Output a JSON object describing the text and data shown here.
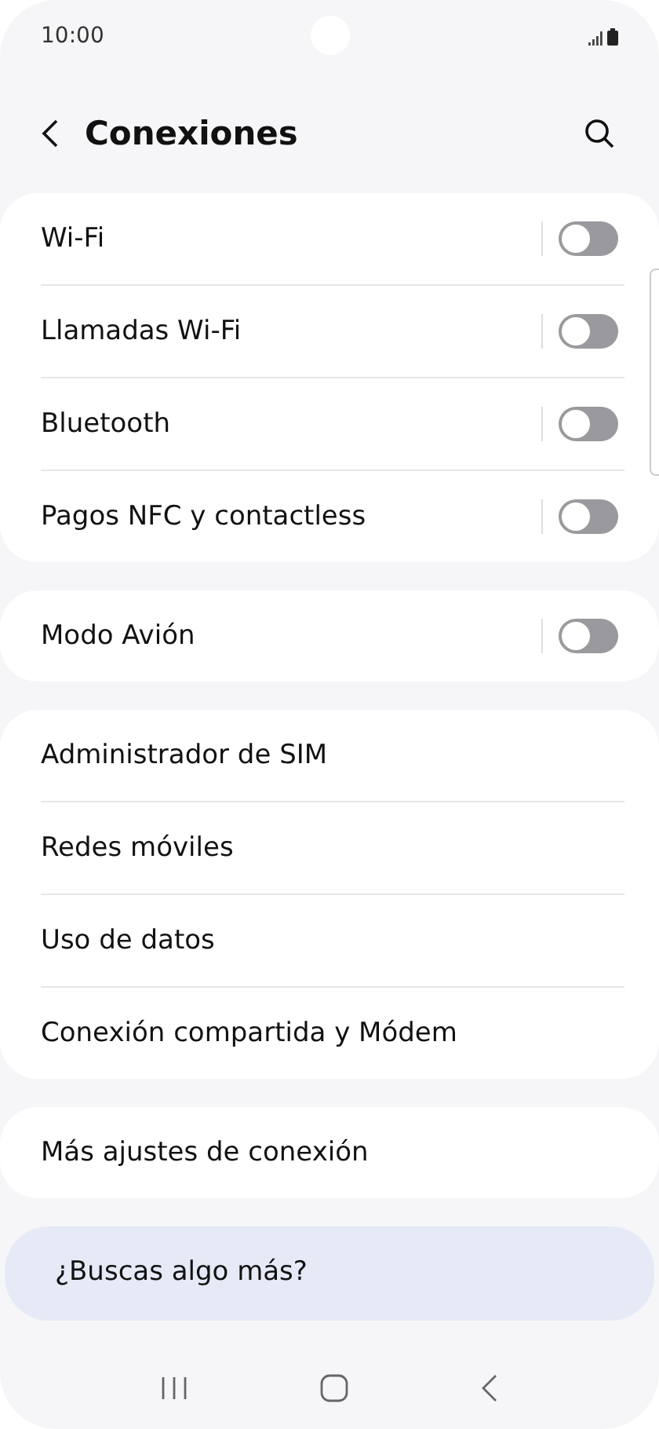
{
  "status_bar": {
    "time": "10:00"
  },
  "header": {
    "title": "Conexiones"
  },
  "groups": [
    {
      "items": [
        {
          "kind": "toggle",
          "label": "Wi-Fi",
          "on": false
        },
        {
          "kind": "toggle",
          "label": "Llamadas Wi-Fi",
          "on": false
        },
        {
          "kind": "toggle",
          "label": "Bluetooth",
          "on": false
        },
        {
          "kind": "toggle",
          "label": "Pagos NFC y contactless",
          "on": false
        }
      ]
    },
    {
      "items": [
        {
          "kind": "toggle",
          "label": "Modo Avión",
          "on": false
        }
      ]
    },
    {
      "items": [
        {
          "kind": "link",
          "label": "Administrador de SIM"
        },
        {
          "kind": "link",
          "label": "Redes móviles"
        },
        {
          "kind": "link",
          "label": "Uso de datos"
        },
        {
          "kind": "link",
          "label": "Conexión compartida y Módem"
        }
      ]
    },
    {
      "items": [
        {
          "kind": "link",
          "label": "Más ajustes de conexión"
        }
      ]
    }
  ],
  "suggestion": {
    "title": "¿Buscas algo más?"
  }
}
